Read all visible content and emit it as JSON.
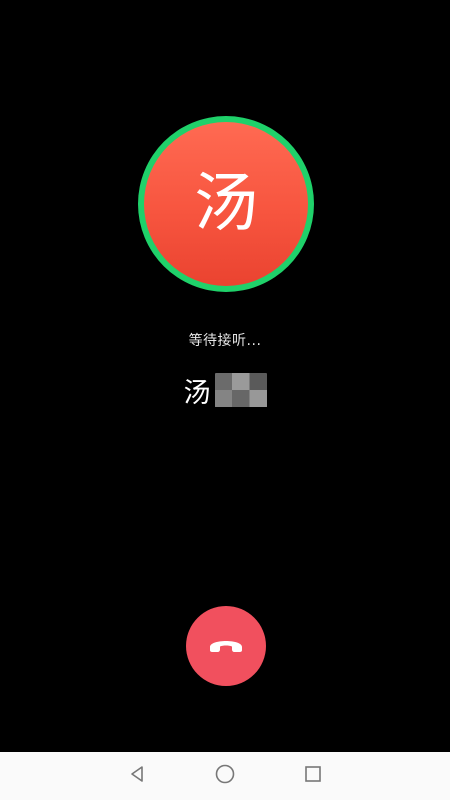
{
  "call": {
    "avatar_char": "汤",
    "status_text": "等待接听...",
    "caller_name_visible": "汤"
  },
  "colors": {
    "ring": "#1fd16a",
    "avatar_fill": "#f7553f",
    "hangup": "#f1505e",
    "background": "#000000",
    "navbar": "#fafafa"
  },
  "icons": {
    "hangup": "phone-hangup-icon",
    "back": "triangle-back-icon",
    "home": "circle-home-icon",
    "recents": "square-recents-icon"
  }
}
